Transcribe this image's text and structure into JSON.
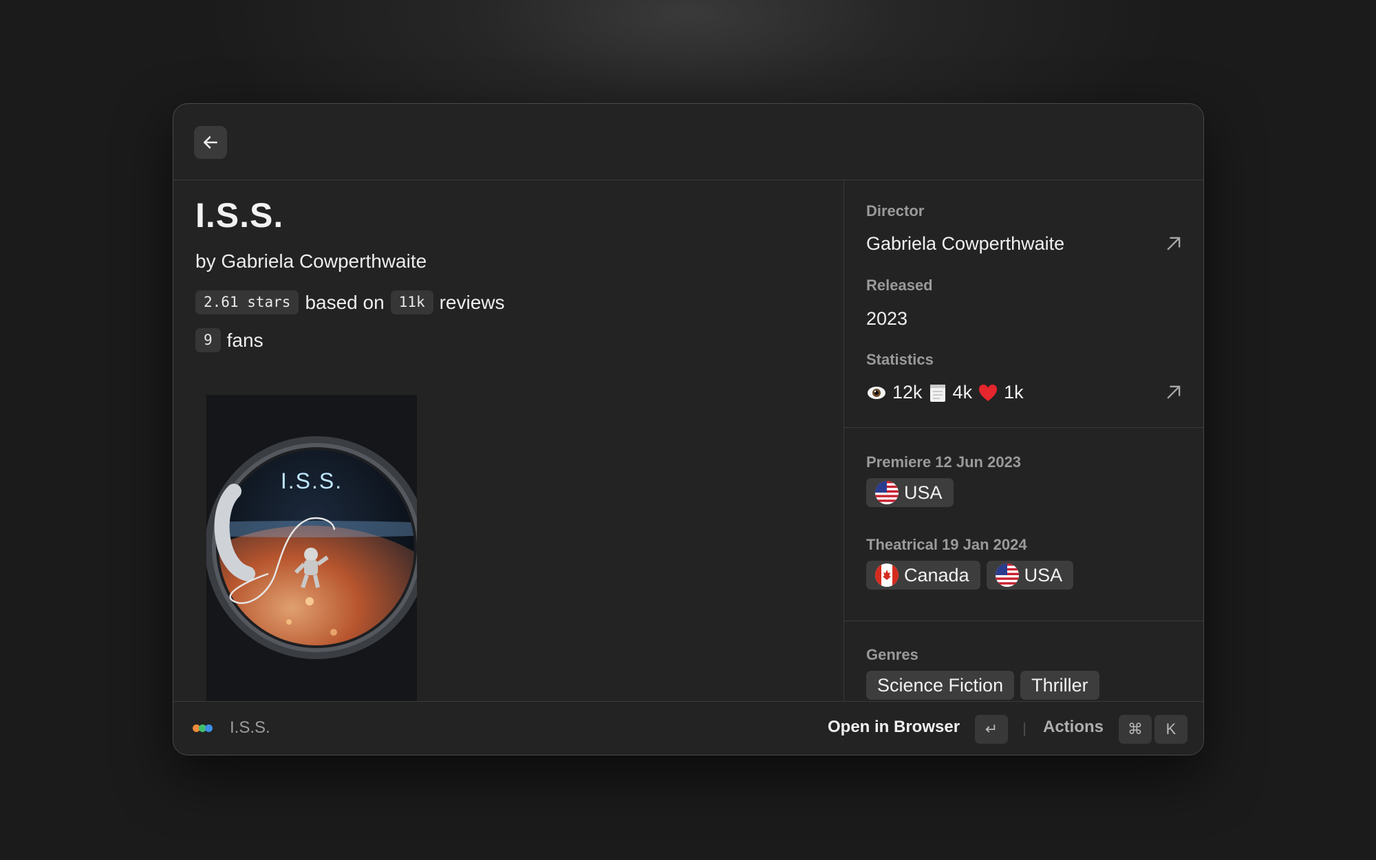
{
  "movie": {
    "title": "I.S.S.",
    "byline": "by Gabriela Cowperthwaite",
    "rating_badge": "2.61 stars",
    "rating_mid": "based on",
    "reviews_badge": "11k",
    "reviews_text": "reviews",
    "fans_badge": "9",
    "fans_text": "fans",
    "poster_title": "I.S.S."
  },
  "sidebar": {
    "director_label": "Director",
    "director_value": "Gabriela Cowperthwaite",
    "released_label": "Released",
    "released_value": "2023",
    "statistics_label": "Statistics",
    "stats": {
      "views": "12k",
      "lists": "4k",
      "likes": "1k"
    },
    "premiere_label": "Premiere 12 Jun 2023",
    "premiere_tags": [
      "USA"
    ],
    "theatrical_label": "Theatrical 19 Jan 2024",
    "theatrical_tags": [
      "Canada",
      "USA"
    ],
    "genres_label": "Genres",
    "genres": [
      "Science Fiction",
      "Thriller"
    ]
  },
  "footer": {
    "title": "I.S.S.",
    "primary_action": "Open in Browser",
    "enter_key": "↵",
    "actions_label": "Actions",
    "cmd_key": "⌘",
    "k_key": "K"
  },
  "icons": {
    "back": "arrow-left-icon",
    "external": "arrow-up-right-icon",
    "views": "eye-emoji",
    "lists": "notepad-emoji",
    "likes": "red-heart-emoji",
    "app": "three-dots-logo"
  },
  "colors": {
    "window_bg": "#232323",
    "tag_bg": "#3d3d3d",
    "label": "#9a9a9a",
    "dot_orange": "#ef8a3c",
    "dot_green": "#3fbf6f",
    "dot_blue": "#3d8fe8"
  }
}
